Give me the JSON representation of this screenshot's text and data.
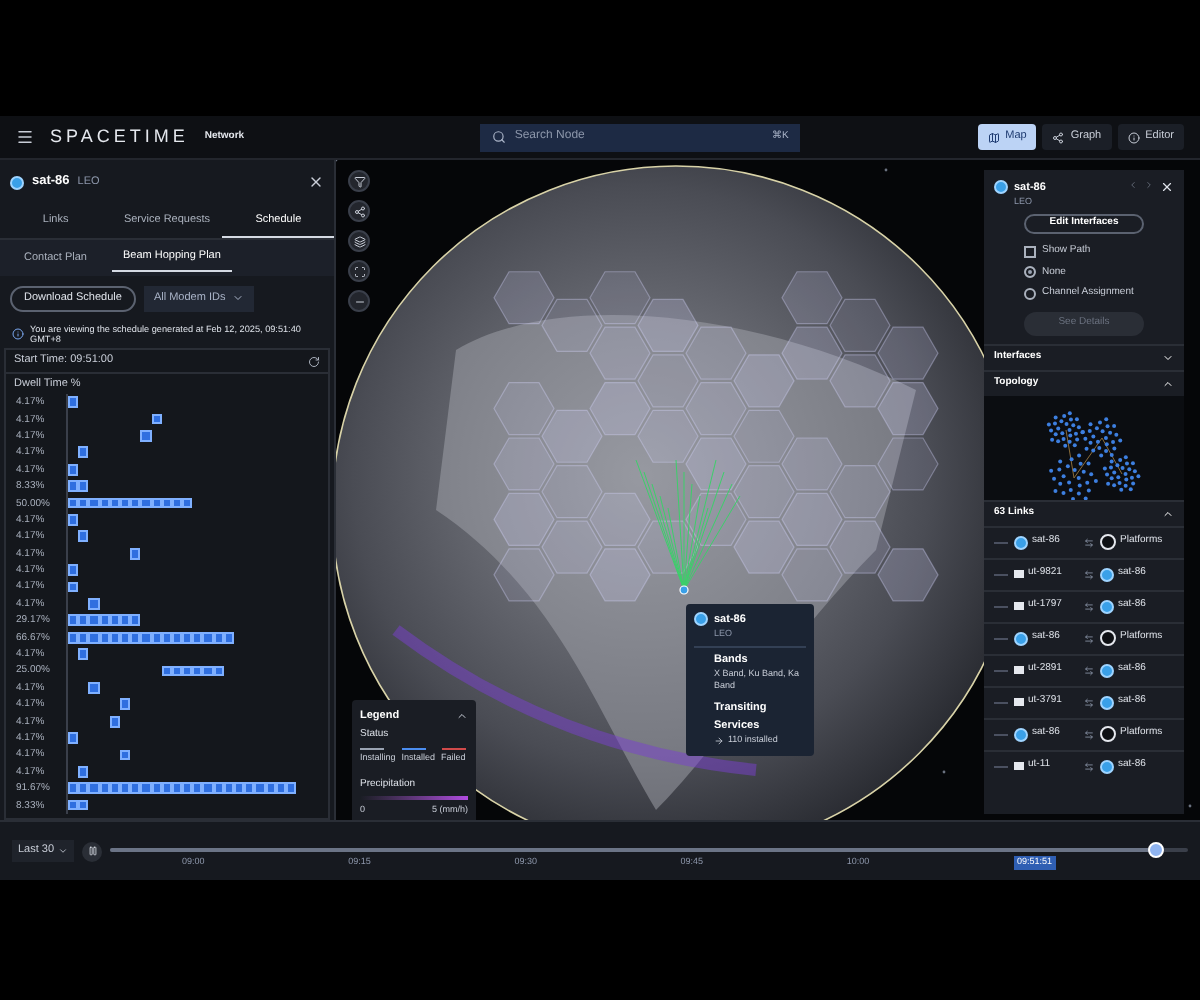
{
  "top_bar": {
    "brand": "SPACETIME",
    "product": "Network",
    "search": {
      "placeholder": "Search Node",
      "shortcut": "⌘K"
    },
    "views": [
      {
        "label": "Map",
        "selected": true
      },
      {
        "label": "Graph",
        "selected": false
      },
      {
        "label": "Editor",
        "selected": false
      }
    ]
  },
  "left_panel": {
    "node": {
      "name": "sat-86",
      "orbit": "LEO"
    },
    "tabs": [
      {
        "label": "Links",
        "selected": false
      },
      {
        "label": "Service Requests",
        "selected": false
      },
      {
        "label": "Schedule",
        "selected": true
      }
    ],
    "subtabs": [
      {
        "label": "Contact Plan",
        "selected": false
      },
      {
        "label": "Beam Hopping Plan",
        "selected": true
      }
    ],
    "download_button": "Download Schedule",
    "modem_filter": "All Modem IDs",
    "notice": "You are viewing the schedule generated at Feb 12, 2025, 09:51:40 GMT+8",
    "start_time": "Start Time: 09:51:00",
    "schedule": {
      "title": "Dwell Time %",
      "rows": [
        {
          "label": "4.17%",
          "slots": [
            true,
            false,
            false,
            false,
            false,
            false,
            false,
            false,
            false,
            false,
            false,
            false,
            false,
            false,
            false,
            false,
            false,
            false,
            false,
            false,
            false,
            false,
            false,
            false
          ]
        },
        {
          "label": "4.17%",
          "slots": [
            false,
            false,
            false,
            false,
            false,
            false,
            false,
            false,
            true,
            false,
            false,
            false,
            false,
            false,
            false,
            false,
            false,
            false,
            false,
            false,
            false,
            false,
            false,
            false
          ]
        },
        {
          "label": "4.17%",
          "slots": [
            false,
            false,
            false,
            false,
            false,
            false,
            false,
            true,
            false,
            false,
            false,
            false,
            false,
            false,
            false,
            false,
            false,
            false,
            false,
            false,
            false,
            false,
            false,
            false
          ]
        },
        {
          "label": "4.17%",
          "slots": [
            false,
            true,
            false,
            false,
            false,
            false,
            false,
            false,
            false,
            false,
            false,
            false,
            false,
            false,
            false,
            false,
            false,
            false,
            false,
            false,
            false,
            false,
            false,
            false
          ]
        },
        {
          "label": "4.17%",
          "slots": [
            true,
            false,
            false,
            false,
            false,
            false,
            false,
            false,
            false,
            false,
            false,
            false,
            false,
            false,
            false,
            false,
            false,
            false,
            false,
            false,
            false,
            false,
            false,
            false
          ]
        },
        {
          "label": "8.33%",
          "slots": [
            true,
            true,
            false,
            false,
            false,
            false,
            false,
            false,
            false,
            false,
            false,
            false,
            false,
            false,
            false,
            false,
            false,
            false,
            false,
            false,
            false,
            false,
            false,
            false
          ]
        },
        {
          "label": "50.00%",
          "slots": [
            true,
            true,
            true,
            true,
            true,
            true,
            true,
            true,
            true,
            true,
            true,
            true,
            false,
            false,
            false,
            false,
            false,
            false,
            false,
            false,
            false,
            false,
            false,
            false
          ]
        },
        {
          "label": "4.17%",
          "slots": [
            true,
            false,
            false,
            false,
            false,
            false,
            false,
            false,
            false,
            false,
            false,
            false,
            false,
            false,
            false,
            false,
            false,
            false,
            false,
            false,
            false,
            false,
            false,
            false
          ]
        },
        {
          "label": "4.17%",
          "slots": [
            false,
            true,
            false,
            false,
            false,
            false,
            false,
            false,
            false,
            false,
            false,
            false,
            false,
            false,
            false,
            false,
            false,
            false,
            false,
            false,
            false,
            false,
            false,
            false
          ]
        },
        {
          "label": "4.17%",
          "slots": [
            false,
            false,
            false,
            false,
            false,
            false,
            true,
            false,
            false,
            false,
            false,
            false,
            false,
            false,
            false,
            false,
            false,
            false,
            false,
            false,
            false,
            false,
            false,
            false
          ]
        },
        {
          "label": "4.17%",
          "slots": [
            true,
            false,
            false,
            false,
            false,
            false,
            false,
            false,
            false,
            false,
            false,
            false,
            false,
            false,
            false,
            false,
            false,
            false,
            false,
            false,
            false,
            false,
            false,
            false
          ]
        },
        {
          "label": "4.17%",
          "slots": [
            true,
            false,
            false,
            false,
            false,
            false,
            false,
            false,
            false,
            false,
            false,
            false,
            false,
            false,
            false,
            false,
            false,
            false,
            false,
            false,
            false,
            false,
            false,
            false
          ]
        },
        {
          "label": "4.17%",
          "slots": [
            false,
            false,
            true,
            false,
            false,
            false,
            false,
            false,
            false,
            false,
            false,
            false,
            false,
            false,
            false,
            false,
            false,
            false,
            false,
            false,
            false,
            false,
            false,
            false
          ]
        },
        {
          "label": "29.17%",
          "slots": [
            true,
            true,
            true,
            true,
            true,
            true,
            true,
            false,
            false,
            false,
            false,
            false,
            false,
            false,
            false,
            false,
            false,
            false,
            false,
            false,
            false,
            false,
            false,
            false
          ]
        },
        {
          "label": "66.67%",
          "slots": [
            true,
            true,
            true,
            true,
            true,
            true,
            true,
            true,
            true,
            true,
            true,
            true,
            true,
            true,
            true,
            true,
            false,
            false,
            false,
            false,
            false,
            false,
            false,
            false
          ]
        },
        {
          "label": "4.17%",
          "slots": [
            false,
            true,
            false,
            false,
            false,
            false,
            false,
            false,
            false,
            false,
            false,
            false,
            false,
            false,
            false,
            false,
            false,
            false,
            false,
            false,
            false,
            false,
            false,
            false
          ]
        },
        {
          "label": "25.00%",
          "slots": [
            false,
            false,
            false,
            false,
            false,
            false,
            false,
            false,
            false,
            true,
            true,
            true,
            true,
            true,
            true,
            false,
            false,
            false,
            false,
            false,
            false,
            false,
            false,
            false
          ]
        },
        {
          "label": "4.17%",
          "slots": [
            false,
            false,
            true,
            false,
            false,
            false,
            false,
            false,
            false,
            false,
            false,
            false,
            false,
            false,
            false,
            false,
            false,
            false,
            false,
            false,
            false,
            false,
            false,
            false
          ]
        },
        {
          "label": "4.17%",
          "slots": [
            false,
            false,
            false,
            false,
            false,
            true,
            false,
            false,
            false,
            false,
            false,
            false,
            false,
            false,
            false,
            false,
            false,
            false,
            false,
            false,
            false,
            false,
            false,
            false
          ]
        },
        {
          "label": "4.17%",
          "slots": [
            false,
            false,
            false,
            false,
            true,
            false,
            false,
            false,
            false,
            false,
            false,
            false,
            false,
            false,
            false,
            false,
            false,
            false,
            false,
            false,
            false,
            false,
            false,
            false
          ]
        },
        {
          "label": "4.17%",
          "slots": [
            true,
            false,
            false,
            false,
            false,
            false,
            false,
            false,
            false,
            false,
            false,
            false,
            false,
            false,
            false,
            false,
            false,
            false,
            false,
            false,
            false,
            false,
            false,
            false
          ]
        },
        {
          "label": "4.17%",
          "slots": [
            false,
            false,
            false,
            false,
            false,
            true,
            false,
            false,
            false,
            false,
            false,
            false,
            false,
            false,
            false,
            false,
            false,
            false,
            false,
            false,
            false,
            false,
            false,
            false
          ]
        },
        {
          "label": "4.17%",
          "slots": [
            false,
            true,
            false,
            false,
            false,
            false,
            false,
            false,
            false,
            false,
            false,
            false,
            false,
            false,
            false,
            false,
            false,
            false,
            false,
            false,
            false,
            false,
            false,
            false
          ]
        },
        {
          "label": "91.67%",
          "slots": [
            true,
            true,
            true,
            true,
            true,
            true,
            true,
            true,
            true,
            true,
            true,
            true,
            true,
            true,
            true,
            true,
            true,
            true,
            true,
            true,
            true,
            true,
            false,
            false
          ]
        },
        {
          "label": "8.33%",
          "slots": [
            true,
            true,
            false,
            false,
            false,
            false,
            false,
            false,
            false,
            false,
            false,
            false,
            false,
            false,
            false,
            false,
            false,
            false,
            false,
            false,
            false,
            false,
            false,
            false
          ]
        }
      ]
    }
  },
  "map": {
    "tooltip": {
      "name": "sat-86",
      "orbit": "LEO",
      "bands_title": "Bands",
      "bands": "X Band, Ku Band, Ka Band",
      "services_title": "Transiting Services",
      "services": "110 installed"
    },
    "legend": {
      "title": "Legend",
      "status_title": "Status",
      "statuses": [
        {
          "label": "Installing",
          "color": "#9aa3b2"
        },
        {
          "label": "Installed",
          "color": "#4b8df0"
        },
        {
          "label": "Failed",
          "color": "#d04a4a"
        }
      ],
      "precipitation_title": "Precipitation",
      "min": "0",
      "max": "5 (mm/h)"
    }
  },
  "details_panel": {
    "name": "sat-86",
    "orbit": "LEO",
    "edit_button": "Edit Interfaces",
    "options": [
      {
        "kind": "checkbox",
        "label": "Show Path",
        "checked": false
      },
      {
        "kind": "radio",
        "label": "None",
        "selected": true
      },
      {
        "kind": "radio",
        "label": "Channel Assignment",
        "selected": false
      }
    ],
    "details_button": {
      "label": "See Details",
      "disabled": true
    },
    "sections": [
      {
        "title": "Interfaces",
        "expanded": false
      },
      {
        "title": "Topology",
        "expanded": true
      }
    ],
    "links_title": "63 Links",
    "links": [
      {
        "from": {
          "kind": "satellite",
          "name": "sat-86"
        },
        "to": {
          "kind": "platform",
          "name": "Platforms"
        }
      },
      {
        "from": {
          "kind": "terminal",
          "name": "ut-9821"
        },
        "to": {
          "kind": "satellite",
          "name": "sat-86"
        }
      },
      {
        "from": {
          "kind": "terminal",
          "name": "ut-1797"
        },
        "to": {
          "kind": "satellite",
          "name": "sat-86"
        }
      },
      {
        "from": {
          "kind": "satellite",
          "name": "sat-86"
        },
        "to": {
          "kind": "platform",
          "name": "Platforms"
        }
      },
      {
        "from": {
          "kind": "terminal",
          "name": "ut-2891"
        },
        "to": {
          "kind": "satellite",
          "name": "sat-86"
        }
      },
      {
        "from": {
          "kind": "terminal",
          "name": "ut-3791"
        },
        "to": {
          "kind": "satellite",
          "name": "sat-86"
        }
      },
      {
        "from": {
          "kind": "satellite",
          "name": "sat-86"
        },
        "to": {
          "kind": "platform",
          "name": "Platforms"
        }
      },
      {
        "from": {
          "kind": "terminal",
          "name": "ut-11"
        },
        "to": {
          "kind": "satellite",
          "name": "sat-86"
        }
      }
    ]
  },
  "timeline": {
    "range": "Last 30",
    "ticks": [
      "09:00",
      "09:15",
      "09:30",
      "09:45",
      "10:00"
    ],
    "current_time": "09:51:51",
    "level": 0.97
  }
}
